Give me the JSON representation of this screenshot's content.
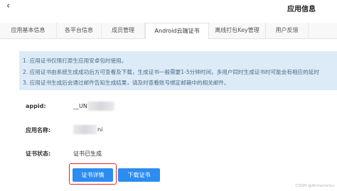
{
  "header": {
    "back_glyph": "‹",
    "title": "应用信息"
  },
  "tabs": [
    {
      "label": "应用基本信息"
    },
    {
      "label": "各平台信息"
    },
    {
      "label": "成员管理"
    },
    {
      "label": "Android云端证书",
      "active": true
    },
    {
      "label": "离线打包Key管理"
    },
    {
      "label": "用户反馈"
    }
  ],
  "notice": {
    "lines": [
      "1. 应用证书仅限打原生应用安卓包时使用。",
      "2. 应用证书由系统生成成功后方可查看及下载，生成证书一般需要1-5分钟时间，多用户同时生成证书时可能会有相应的延时",
      "3. 应用证书生成后会通过邮件告知生成结果，请及时查看账号绑定邮箱中的相关邮件。"
    ]
  },
  "fields": {
    "appid_label": "appid:",
    "appid_value_prefix": "__UN",
    "app_name_label": "应用名称:",
    "app_name_value_suffix": "ni",
    "cert_status_label": "证书状态:",
    "cert_status_value": "证书已生成"
  },
  "buttons": {
    "cert_details": "证书详情",
    "download_cert": "下载证书"
  },
  "watermark": "CSDN @Ahmerorizu"
}
